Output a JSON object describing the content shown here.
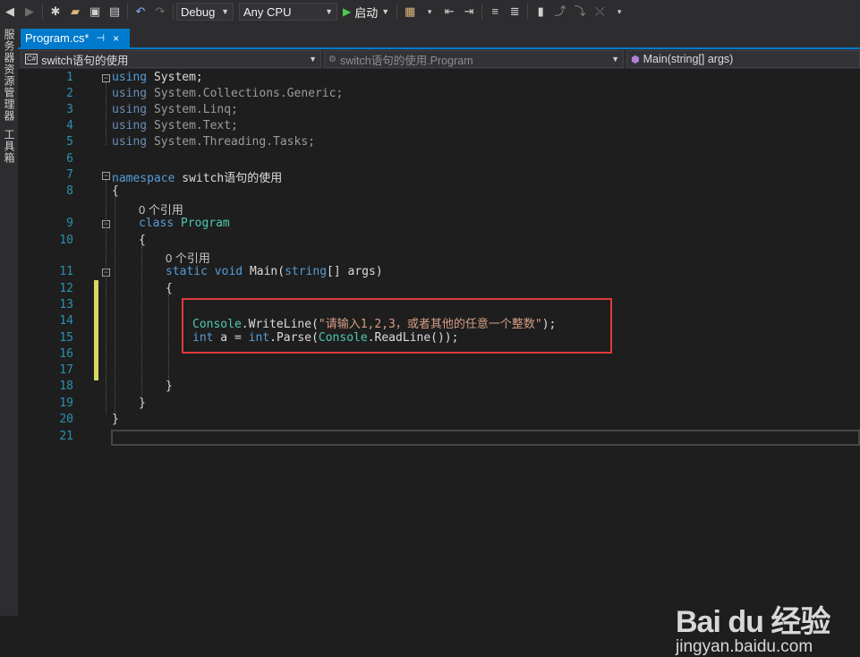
{
  "toolbar": {
    "config": "Debug",
    "platform": "Any CPU",
    "start_label": "启动"
  },
  "side_tabs": {
    "server_explorer": "服务器资源管理器",
    "toolbox": "工具箱"
  },
  "tab": {
    "label": "Program.cs*",
    "pin": "⊣",
    "close": "×"
  },
  "nav": {
    "project": "switch语句的使用",
    "class": "switch语句的使用.Program",
    "member": "Main(string[] args)"
  },
  "line_numbers": [
    "1",
    "2",
    "3",
    "4",
    "5",
    "6",
    "7",
    "8",
    "9",
    "10",
    "11",
    "12",
    "13",
    "14",
    "15",
    "16",
    "17",
    "18",
    "19",
    "20",
    "21"
  ],
  "code": {
    "using_kw": "using",
    "u1": " System;",
    "u2": " System.Collections.Generic;",
    "u3": " System.Linq;",
    "u4": " System.Text;",
    "u5": " System.Threading.Tasks;",
    "namespace_kw": "namespace",
    "namespace_name": " switch语句的使用",
    "open_brace": "{",
    "close_brace": "}",
    "refs": "0 个引用",
    "class_kw": "class",
    "class_name": "Program",
    "static_kw": "static",
    "void_kw": "void",
    "main": "Main(",
    "string_kw": "string",
    "args": "[] args)",
    "console": "Console",
    "dot": ".",
    "writeline": "WriteLine",
    "lparen": "(",
    "literal": "\"请输入1,2,3，或者其他的任意一个整数\"",
    "rparen_semi": ");",
    "int_kw": "int",
    "a_assign": " a = ",
    "parse": "Parse",
    "readline": "ReadLine",
    "end_parse": "());"
  },
  "watermark": {
    "logo": "Bai du 经验",
    "url": "jingyan.baidu.com"
  }
}
